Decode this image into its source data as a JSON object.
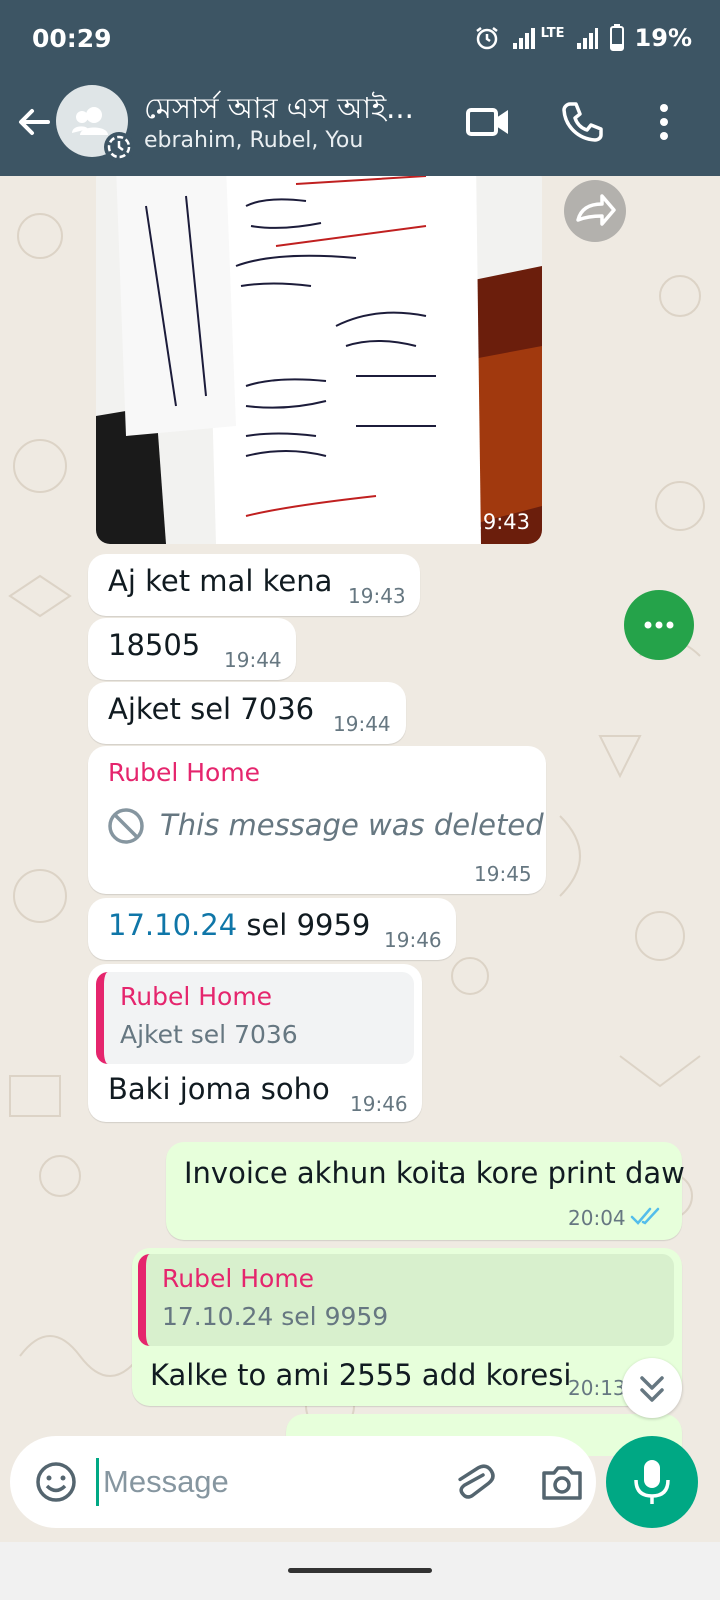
{
  "status": {
    "time": "00:29",
    "network": "LTE",
    "battery": "19%"
  },
  "header": {
    "title": "মেসার্স আর এস আই...",
    "subtitle": "ebrahim, Rubel, You"
  },
  "photo": {
    "time": "19:43",
    "handwriting": [
      "৬১০৬১",
      "নতুনউইমীত",
      "৩৫২০",
      "৩০৮৮",
      "২০২৬৪",
      "১০০০",
      "৪৯০",
      "১৫৬৪৮",
      "মোট - ২২,৫৫৫"
    ]
  },
  "messages": [
    {
      "text": "Aj ket mal kena",
      "time": "19:43"
    },
    {
      "text": "18505",
      "time": "19:44"
    },
    {
      "text": "Ajket sel 7036",
      "time": "19:44"
    },
    {
      "sender": "Rubel Home",
      "deleted_text": "This message was deleted",
      "time": "19:45"
    },
    {
      "link": "17.10.24",
      "text": " sel 9959",
      "time": "19:46"
    },
    {
      "quote_name": "Rubel Home",
      "quote_text": "Ajket sel 7036",
      "text": "Baki joma soho",
      "time": "19:46"
    },
    {
      "text": "Invoice akhun koita kore print daw",
      "time": "20:04"
    },
    {
      "quote_name": "Rubel Home",
      "quote_text": "17.10.24 sel 9959",
      "text": "Kalke to ami 2555 add koresi",
      "time": "20:13"
    }
  ],
  "composer": {
    "placeholder": "Message"
  },
  "colors": {
    "header": "#3d5564",
    "accent": "#00a884",
    "outgoing": "#e7ffdb",
    "sender": "#e5256d",
    "link": "#0f76a8"
  },
  "icons": [
    "back-arrow-icon",
    "group-avatar-icon",
    "video-call-icon",
    "phone-icon",
    "more-icon",
    "forward-icon",
    "deleted-icon",
    "double-tick-icon",
    "emoji-icon",
    "attach-icon",
    "camera-icon",
    "mic-icon",
    "scroll-down-icon"
  ]
}
